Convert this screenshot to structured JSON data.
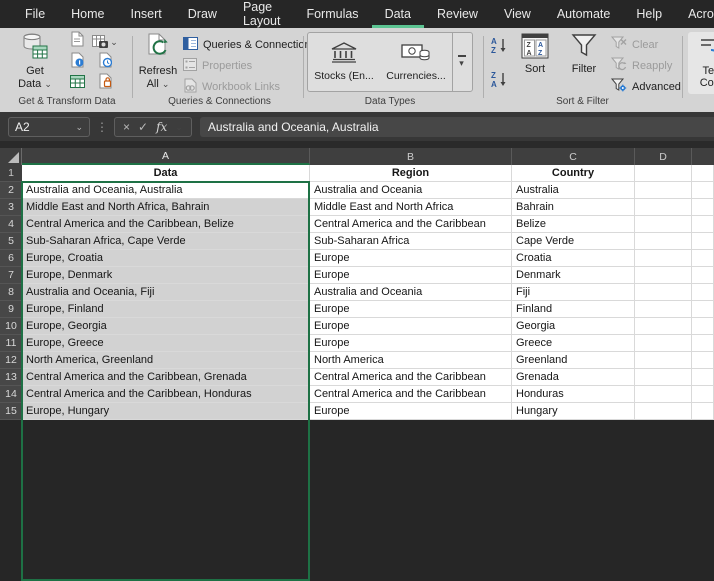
{
  "colors": {
    "accent_green": "#1e7145",
    "tab_underline_green": "#5cc492",
    "selection_fill": "#d2d2d2",
    "menubar_bg": "#262626",
    "ribbon_bg": "#d4d4d4"
  },
  "menu": {
    "tabs": [
      "File",
      "Home",
      "Insert",
      "Draw",
      "Page Layout",
      "Formulas",
      "Data",
      "Review",
      "View",
      "Automate",
      "Help",
      "Acrobat"
    ],
    "active_tab": "Data"
  },
  "ribbon": {
    "get_transform": {
      "group_label": "Get & Transform Data",
      "get_data_line1": "Get",
      "get_data_line2": "Data"
    },
    "queries": {
      "group_label": "Queries & Connections",
      "refresh_line1": "Refresh",
      "refresh_line2": "All",
      "items": [
        {
          "label": "Queries & Connections",
          "enabled": true
        },
        {
          "label": "Properties",
          "enabled": false
        },
        {
          "label": "Workbook Links",
          "enabled": false
        }
      ]
    },
    "data_types": {
      "group_label": "Data Types",
      "tiles": [
        {
          "label": "Stocks (En..."
        },
        {
          "label": "Currencies..."
        }
      ]
    },
    "sort_filter": {
      "group_label": "Sort & Filter",
      "sort_label": "Sort",
      "filter_label": "Filter",
      "items": [
        {
          "label": "Clear",
          "enabled": false
        },
        {
          "label": "Reapply",
          "enabled": false
        },
        {
          "label": "Advanced",
          "enabled": true
        }
      ]
    },
    "text_to_columns": {
      "line1": "Tex",
      "line2": "Colu"
    }
  },
  "formula_bar": {
    "name_box": "A2",
    "formula": "Australia and Oceania, Australia"
  },
  "sheet": {
    "col_headers": [
      "A",
      "B",
      "C",
      "D"
    ],
    "selected_column": "A",
    "selected_range": "A2:A15",
    "rows": [
      {
        "n": "1",
        "a": "Data",
        "b": "Region",
        "c": "Country"
      },
      {
        "n": "2",
        "a": "Australia and Oceania, Australia",
        "b": "Australia and Oceania",
        "c": "Australia"
      },
      {
        "n": "3",
        "a": "Middle East and North Africa, Bahrain",
        "b": "Middle East and North Africa",
        "c": "Bahrain"
      },
      {
        "n": "4",
        "a": "Central America and the Caribbean, Belize",
        "b": "Central America and the Caribbean",
        "c": "Belize"
      },
      {
        "n": "5",
        "a": "Sub-Saharan Africa, Cape Verde",
        "b": "Sub-Saharan Africa",
        "c": "Cape Verde"
      },
      {
        "n": "6",
        "a": "Europe, Croatia",
        "b": "Europe",
        "c": "Croatia"
      },
      {
        "n": "7",
        "a": "Europe, Denmark",
        "b": "Europe",
        "c": "Denmark"
      },
      {
        "n": "8",
        "a": "Australia and Oceania, Fiji",
        "b": "Australia and Oceania",
        "c": "Fiji"
      },
      {
        "n": "9",
        "a": "Europe, Finland",
        "b": "Europe",
        "c": "Finland"
      },
      {
        "n": "10",
        "a": "Europe, Georgia",
        "b": "Europe",
        "c": "Georgia"
      },
      {
        "n": "11",
        "a": "Europe, Greece",
        "b": "Europe",
        "c": "Greece"
      },
      {
        "n": "12",
        "a": "North America, Greenland",
        "b": "North America",
        "c": "Greenland"
      },
      {
        "n": "13",
        "a": "Central America and the Caribbean, Grenada",
        "b": "Central America and the Caribbean",
        "c": "Grenada"
      },
      {
        "n": "14",
        "a": "Central America and the Caribbean, Honduras",
        "b": "Central America and the Caribbean",
        "c": "Honduras"
      },
      {
        "n": "15",
        "a": "Europe, Hungary",
        "b": "Europe",
        "c": "Hungary"
      }
    ]
  }
}
